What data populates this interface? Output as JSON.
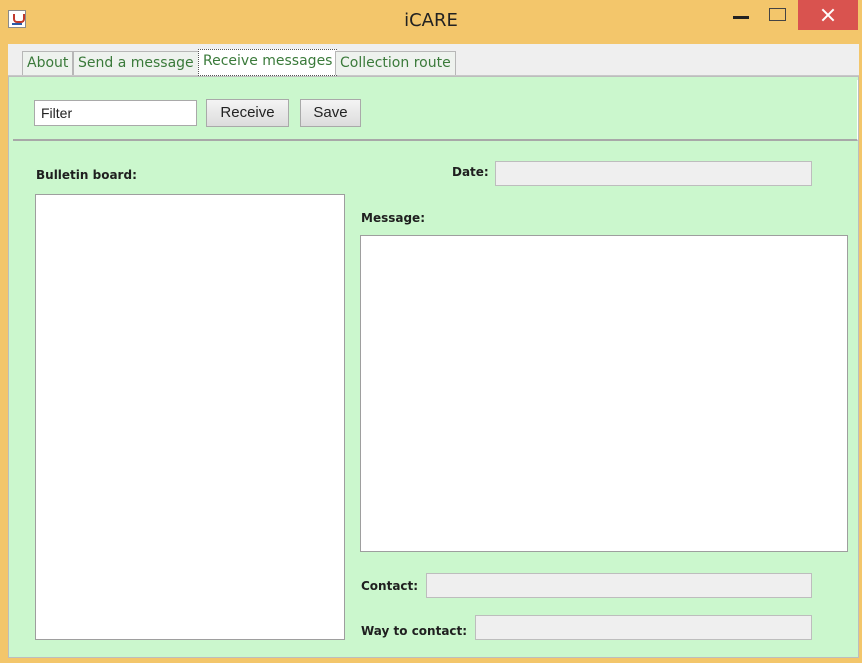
{
  "window": {
    "title": "iCARE",
    "icons": {
      "app": "java-app-icon",
      "minimize": "minimize-icon",
      "maximize": "maximize-icon",
      "close": "close-icon"
    },
    "close_color": "#d9534f",
    "frame_color": "#f3c66b"
  },
  "tabs": [
    {
      "label": "About",
      "active": false
    },
    {
      "label": "Send a message",
      "active": false
    },
    {
      "label": "Receive messages",
      "active": true
    },
    {
      "label": "Collection route",
      "active": false
    }
  ],
  "toolbar": {
    "filter_value": "Filter",
    "receive_label": "Receive",
    "save_label": "Save"
  },
  "form": {
    "bulletin_label": "Bulletin board:",
    "date_label": "Date:",
    "date_value": "",
    "message_label": "Message:",
    "message_value": "",
    "contact_label": "Contact:",
    "contact_value": "",
    "way_label": "Way to contact:",
    "way_value": ""
  },
  "colors": {
    "pane_background": "#cbf7cd",
    "tab_text": "#3a7a3a"
  }
}
